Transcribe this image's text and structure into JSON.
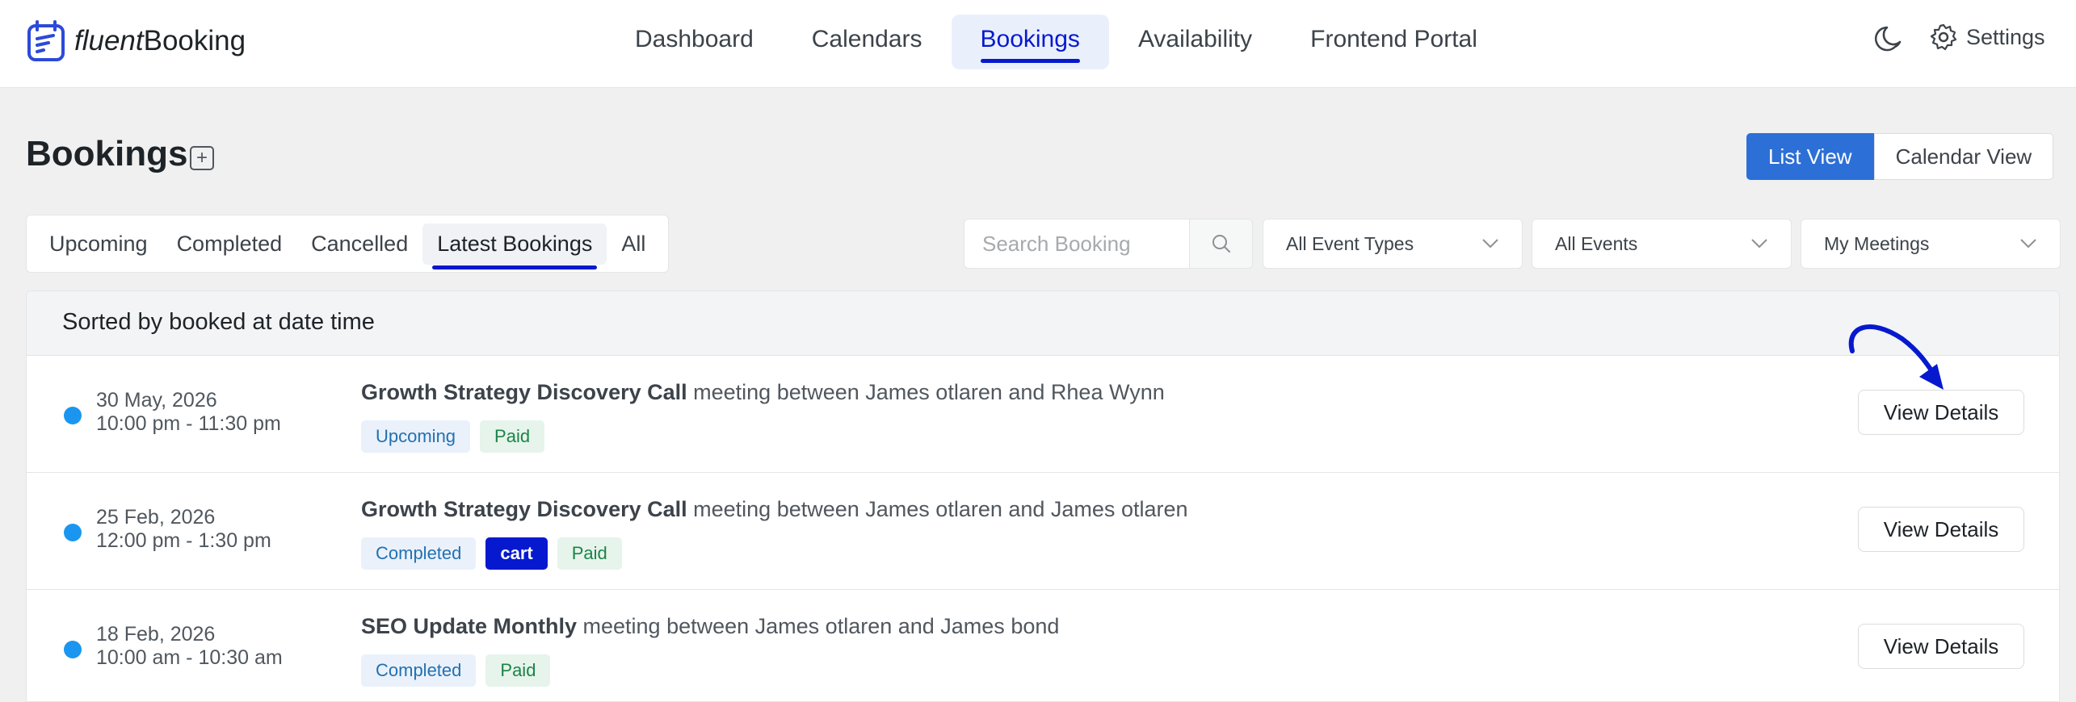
{
  "app": {
    "logo_part1": "fluent",
    "logo_part2": "Booking"
  },
  "nav": {
    "items": [
      {
        "label": "Dashboard",
        "active": false
      },
      {
        "label": "Calendars",
        "active": false
      },
      {
        "label": "Bookings",
        "active": true
      },
      {
        "label": "Availability",
        "active": false
      },
      {
        "label": "Frontend Portal",
        "active": false
      }
    ],
    "settings_label": "Settings"
  },
  "page": {
    "title": "Bookings"
  },
  "view_toggle": {
    "list": "List View",
    "calendar": "Calendar View",
    "active": "List View"
  },
  "tabs": [
    {
      "label": "Upcoming",
      "active": false
    },
    {
      "label": "Completed",
      "active": false
    },
    {
      "label": "Cancelled",
      "active": false
    },
    {
      "label": "Latest Bookings",
      "active": true
    },
    {
      "label": "All",
      "active": false
    }
  ],
  "search": {
    "placeholder": "Search Booking",
    "value": ""
  },
  "filters": {
    "event_types": "All Event Types",
    "events": "All Events",
    "meetings": "My Meetings"
  },
  "list": {
    "header": "Sorted by booked at date time",
    "rows": [
      {
        "date": "30 May, 2026",
        "time": "10:00 pm - 11:30 pm",
        "event": "Growth Strategy Discovery Call",
        "description": " meeting between James otlaren and Rhea Wynn",
        "badges": [
          "Upcoming",
          "Paid"
        ],
        "action": "View Details"
      },
      {
        "date": "25 Feb, 2026",
        "time": "12:00 pm - 1:30 pm",
        "event": "Growth Strategy Discovery Call",
        "description": " meeting between James otlaren and James otlaren",
        "badges": [
          "Completed",
          "cart",
          "Paid"
        ],
        "action": "View Details"
      },
      {
        "date": "18 Feb, 2026",
        "time": "10:00 am - 10:30 am",
        "event": "SEO Update Monthly",
        "description": " meeting between James otlaren and James bond",
        "badges": [
          "Completed",
          "Paid"
        ],
        "action": "View Details"
      }
    ]
  },
  "colors": {
    "accent": "#0719cf",
    "primary_button": "#2c6fd7",
    "status_dot": "#1a96f0",
    "paid_bg": "#e6f4ec",
    "paid_text": "#1d8348",
    "status_bg": "#eaf1fb",
    "status_text": "#2271b1"
  }
}
